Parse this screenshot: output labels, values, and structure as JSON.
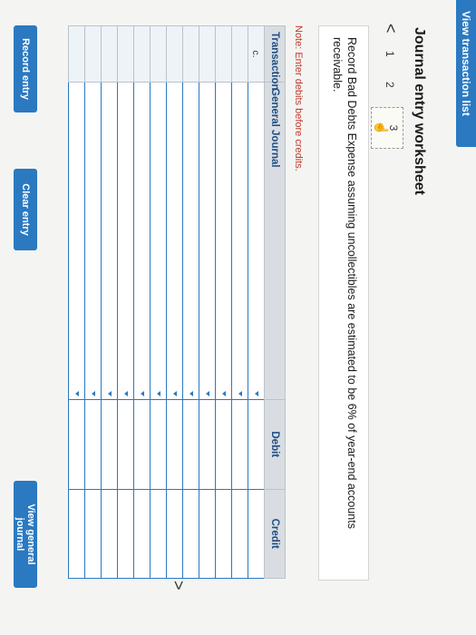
{
  "header": {
    "view_transaction_list": "View transaction list"
  },
  "title": "Journal entry worksheet",
  "pagination": {
    "prev": "<",
    "next": ">",
    "pages": [
      "1",
      "2",
      "3"
    ],
    "current": "3"
  },
  "instruction": "Record Bad Debts Expense assuming uncollectibles are estimated to be 6% of year-end accounts receivable.",
  "note": "Note: Enter debits before credits.",
  "table": {
    "headers": {
      "transaction": "Transaction",
      "general_journal": "General Journal",
      "debit": "Debit",
      "credit": "Credit"
    },
    "rows": [
      {
        "transaction": "c.",
        "account": "",
        "debit": "",
        "credit": ""
      },
      {
        "transaction": "",
        "account": "",
        "debit": "",
        "credit": ""
      },
      {
        "transaction": "",
        "account": "",
        "debit": "",
        "credit": ""
      },
      {
        "transaction": "",
        "account": "",
        "debit": "",
        "credit": ""
      },
      {
        "transaction": "",
        "account": "",
        "debit": "",
        "credit": ""
      },
      {
        "transaction": "",
        "account": "",
        "debit": "",
        "credit": ""
      },
      {
        "transaction": "",
        "account": "",
        "debit": "",
        "credit": ""
      },
      {
        "transaction": "",
        "account": "",
        "debit": "",
        "credit": ""
      },
      {
        "transaction": "",
        "account": "",
        "debit": "",
        "credit": ""
      },
      {
        "transaction": "",
        "account": "",
        "debit": "",
        "credit": ""
      },
      {
        "transaction": "",
        "account": "",
        "debit": "",
        "credit": ""
      },
      {
        "transaction": "",
        "account": "",
        "debit": "",
        "credit": ""
      }
    ]
  },
  "buttons": {
    "record": "Record entry",
    "clear": "Clear entry",
    "view": "View general journal"
  },
  "colors": {
    "accent": "#2b79c1",
    "note": "#c0392b"
  }
}
